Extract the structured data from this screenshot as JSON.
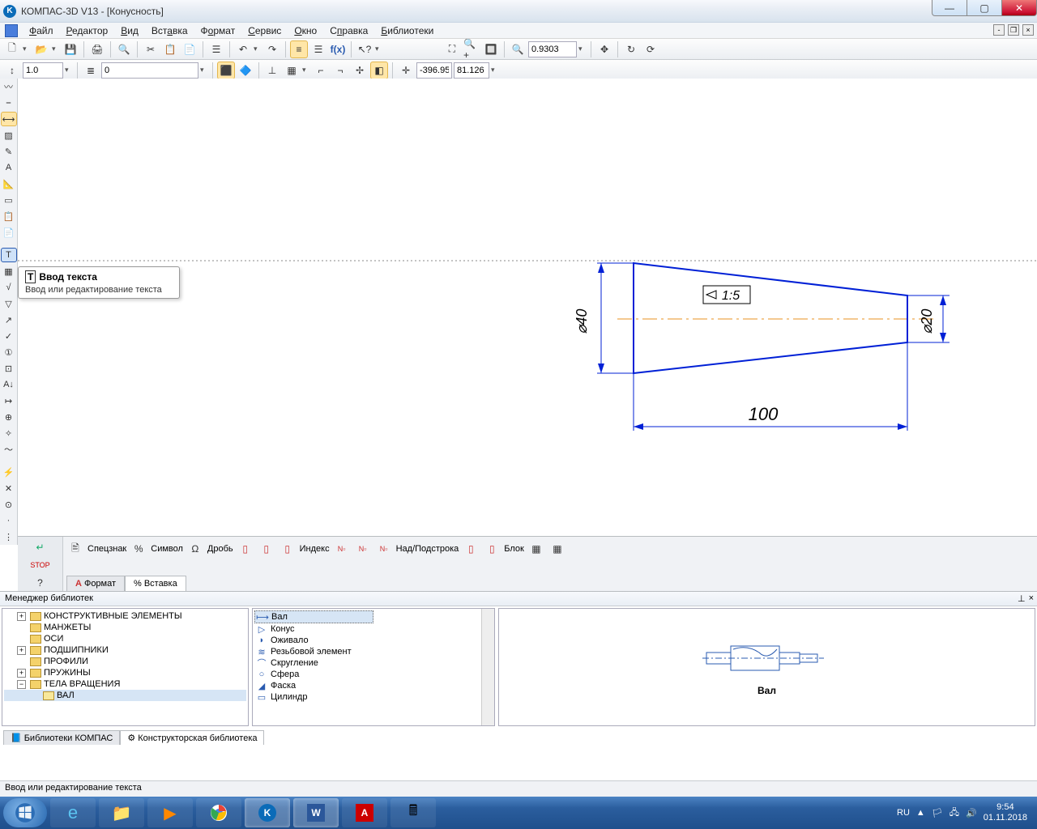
{
  "title": "КОМПАС-3D V13 - [Конусность]",
  "menus": [
    "Файл",
    "Редактор",
    "Вид",
    "Вставка",
    "Формат",
    "Сервис",
    "Окно",
    "Справка",
    "Библиотеки"
  ],
  "toolbar2": {
    "scale": "1.0",
    "style": "0",
    "coordX": "-396.95",
    "coordY": "81.126"
  },
  "zoom_value": "0.9303",
  "tooltip": {
    "title": "Ввод текста",
    "body": "Ввод или редактирование текста"
  },
  "drawing": {
    "dim_left": "⌀40",
    "dim_right": "⌀20",
    "dim_bottom": "100",
    "taper": "1:5"
  },
  "prop": {
    "btn_spec": "Спецзнак",
    "btn_symbol": "Символ",
    "btn_frac": "Дробь",
    "btn_index": "Индекс",
    "btn_supsub": "Над/Подстрока",
    "btn_block": "Блок",
    "tab_format": "Формат",
    "tab_insert": "Вставка"
  },
  "libmgr": {
    "title": "Менеджер библиотек",
    "tree": [
      "КОНСТРУКТИВНЫЕ ЭЛЕМЕНТЫ",
      "МАНЖЕТЫ",
      "ОСИ",
      "ПОДШИПНИКИ",
      "ПРОФИЛИ",
      "ПРУЖИНЫ",
      "ТЕЛА ВРАЩЕНИЯ"
    ],
    "tree_child": "ВАЛ",
    "list_left": [
      "Вал",
      "Конус",
      "Оживало",
      "Резьбовой элемент",
      "Скругление",
      "Сфера",
      "Фаска"
    ],
    "list_right": [
      "Цилиндр"
    ],
    "preview_label": "Вал",
    "tabs": [
      "Библиотеки КОМПАС",
      "Конструкторская библиотека"
    ]
  },
  "status": "Ввод или редактирование текста",
  "tray": {
    "lang": "RU",
    "time": "9:54",
    "date": "01.11.2018"
  }
}
